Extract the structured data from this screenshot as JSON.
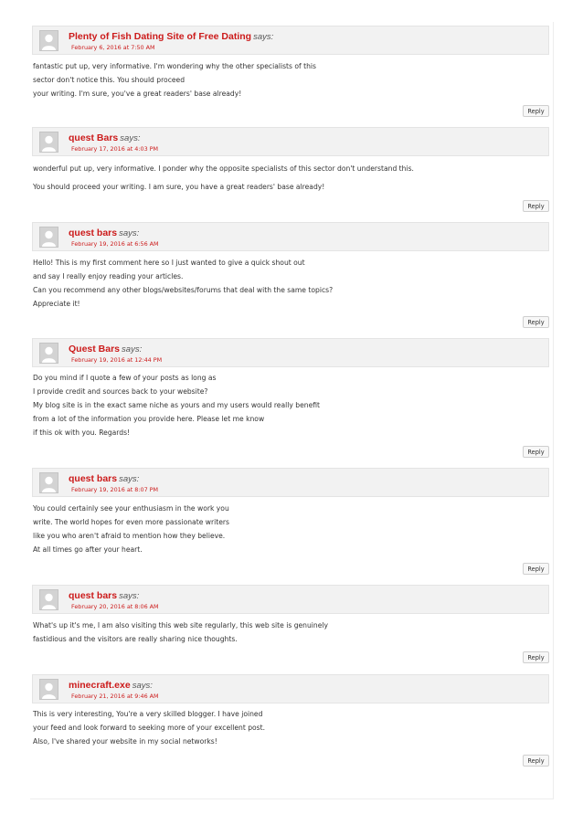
{
  "comments": [
    {
      "author": "Plenty of Fish Dating Site of Free Dating",
      "says": "says:",
      "date": "February 6, 2016 at 7:50 AM",
      "lines": [
        "fantastic put up, very informative. I'm wondering why the other specialists of this",
        "sector don't notice this. You should proceed",
        "your writing. I'm sure, you've a great readers' base already!"
      ],
      "reply": "Reply"
    },
    {
      "author": "quest Bars",
      "says": "says:",
      "date": "February 17, 2016 at 4:03 PM",
      "lines": [
        "wonderful put up, very informative. I ponder why the opposite specialists of this sector don't understand this.",
        "You should proceed your writing. I am sure, you have a great readers' base already!"
      ],
      "reply": "Reply"
    },
    {
      "author": "quest bars",
      "says": "says:",
      "date": "February 19, 2016 at 6:56 AM",
      "lines": [
        "Hello! This is my first comment here so I just wanted to give a quick shout out",
        "and say I really enjoy reading your articles.",
        "Can you recommend any other blogs/websites/forums that deal with the same topics?",
        "Appreciate it!"
      ],
      "reply": "Reply"
    },
    {
      "author": "Quest Bars",
      "says": "says:",
      "date": "February 19, 2016 at 12:44 PM",
      "lines": [
        "Do you mind if I quote a few of your posts as long as",
        "I provide credit and sources back to your website?",
        "My blog site is in the exact same niche as yours and my users would really benefit",
        "from a lot of the information you provide here. Please let me know",
        "if this ok with you. Regards!"
      ],
      "reply": "Reply"
    },
    {
      "author": "quest bars",
      "says": "says:",
      "date": "February 19, 2016 at 8:07 PM",
      "lines": [
        "You could certainly see your enthusiasm in the work you",
        "write. The world hopes for even more passionate writers",
        "like you who aren't afraid to mention how they believe.",
        "At all times go after your heart."
      ],
      "reply": "Reply"
    },
    {
      "author": "quest bars",
      "says": "says:",
      "date": "February 20, 2016 at 8:06 AM",
      "lines": [
        "What's up it's me, I am also visiting this web site regularly, this web site is genuinely",
        "fastidious and the visitors are really sharing nice thoughts."
      ],
      "reply": "Reply"
    },
    {
      "author": "minecraft.exe",
      "says": "says:",
      "date": "February 21, 2016 at 9:46 AM",
      "lines": [
        "This is very interesting, You're a very skilled blogger. I have joined",
        "your feed and look forward to seeking more of your excellent post.",
        "Also, I've shared your website in my social networks!"
      ],
      "reply": "Reply"
    }
  ]
}
